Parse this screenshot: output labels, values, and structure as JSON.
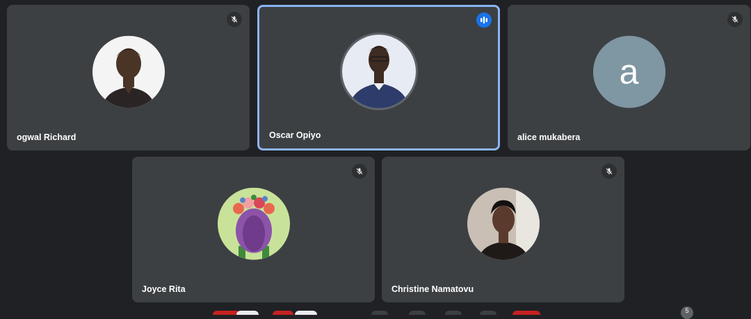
{
  "participants": [
    {
      "name": "ogwal Richard",
      "muted": true,
      "speaking": false,
      "avatar": "photo-icon"
    },
    {
      "name": "Oscar Opiyo",
      "muted": false,
      "speaking": true,
      "avatar": "photo-icon"
    },
    {
      "name": "alice mukabera",
      "muted": true,
      "speaking": false,
      "avatar_letter": "a",
      "avatar_color": "#7f97a3"
    },
    {
      "name": "Joyce Rita",
      "muted": true,
      "speaking": false,
      "avatar": "illustration-icon"
    },
    {
      "name": "Christine Namatovu",
      "muted": true,
      "speaking": false,
      "avatar": "photo-icon"
    }
  ],
  "colors": {
    "background": "#202124",
    "tile": "#3c4043",
    "speaking_border": "#8ab4f8",
    "speaking_badge": "#1a73e8"
  },
  "toolbar": {
    "participant_count": "5"
  }
}
